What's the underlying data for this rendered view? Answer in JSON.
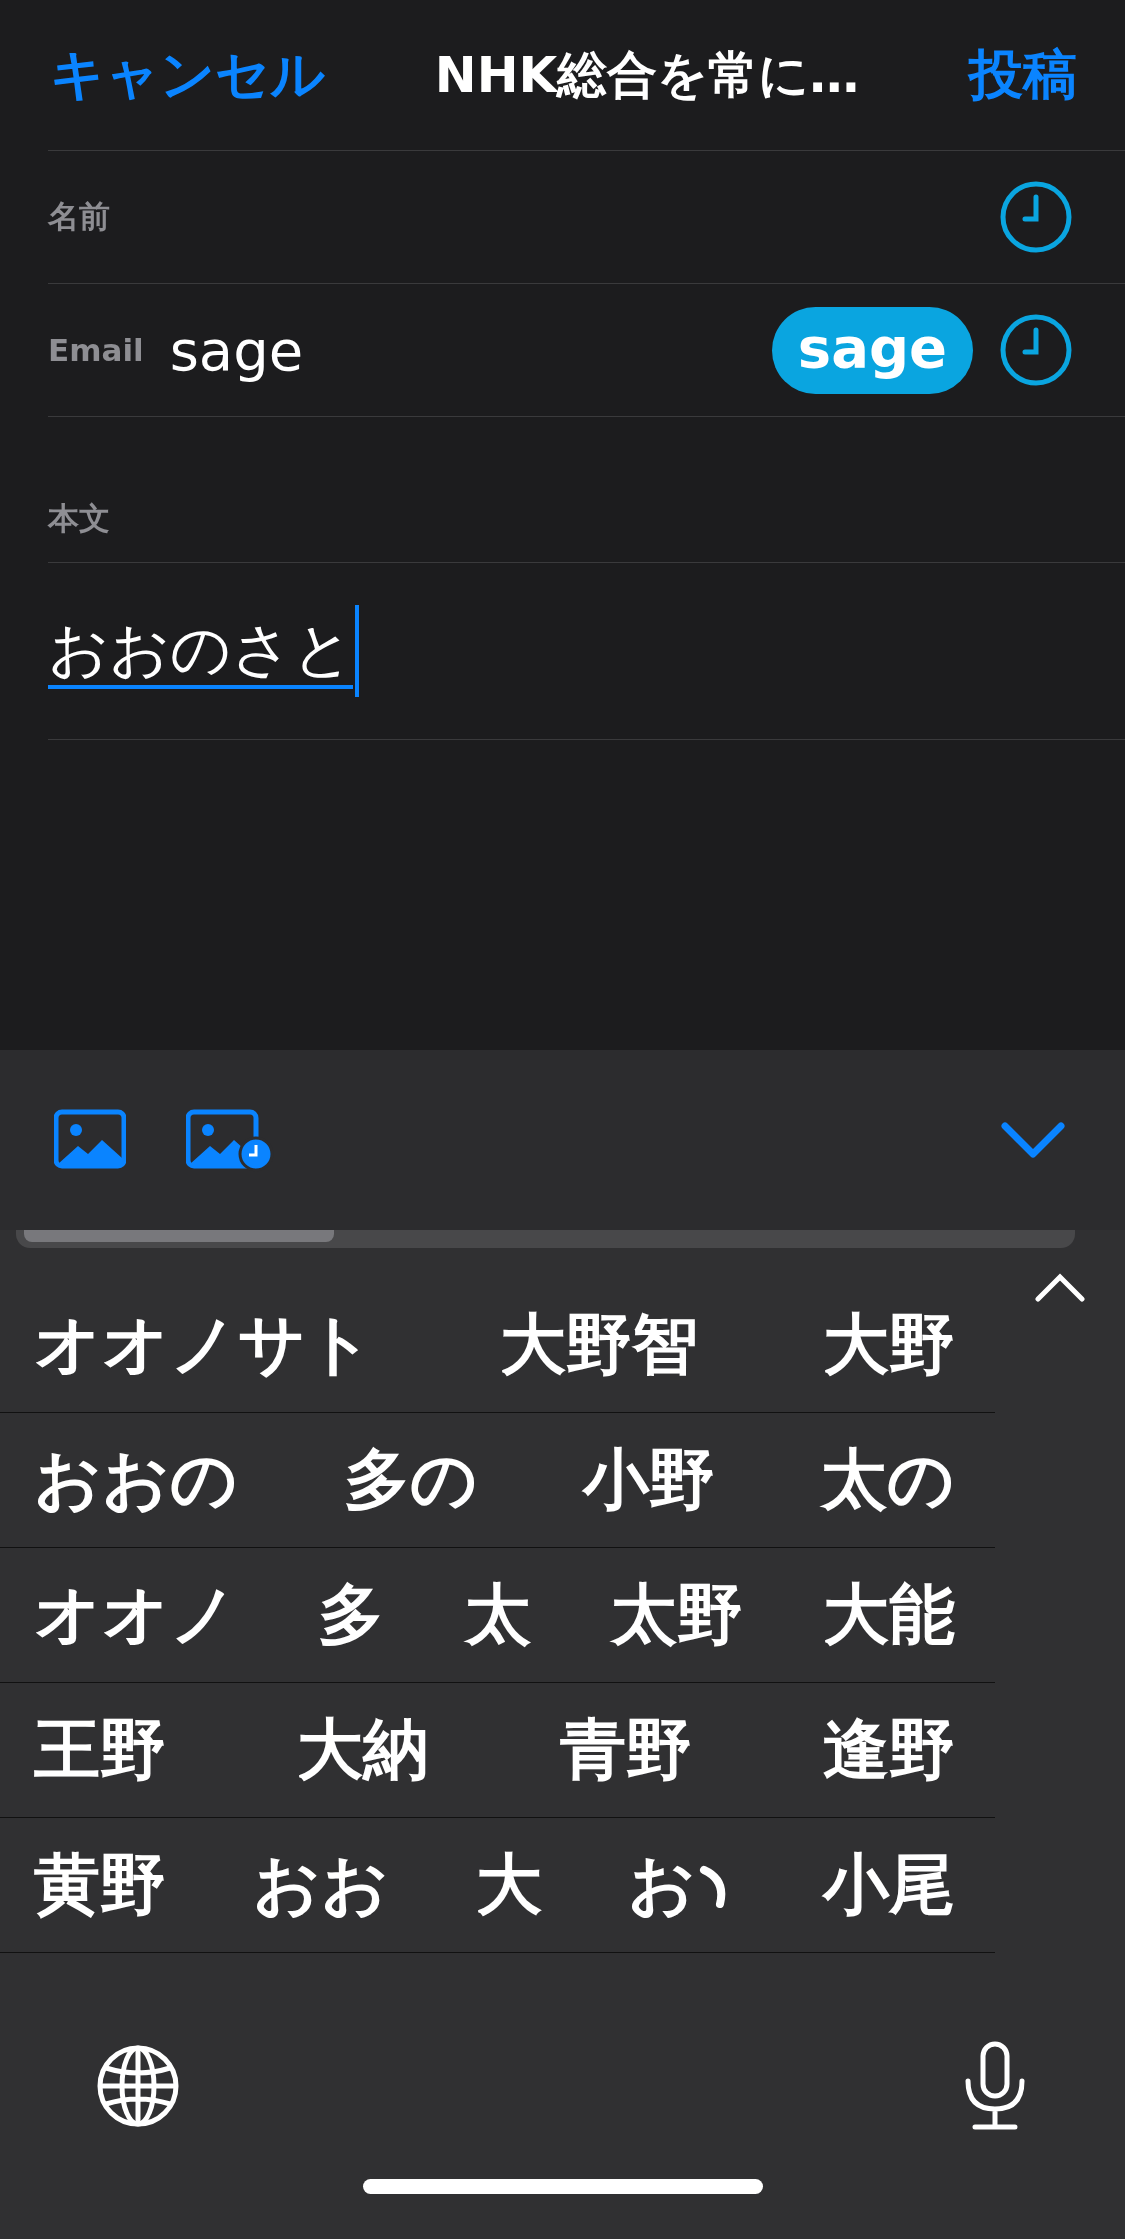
{
  "nav": {
    "cancel": "キャンセル",
    "title": "NHK総合を常に…",
    "post": "投稿"
  },
  "fields": [
    {
      "label": "名前"
    },
    {
      "label": "Email",
      "value": "sage",
      "suggestion": "sage"
    }
  ],
  "body": {
    "label": "本文",
    "value": "おおのさと"
  },
  "candidates": [
    [
      "オオノサト",
      "大野智",
      "大野"
    ],
    [
      "おおの",
      "多の",
      "小野",
      "太の"
    ],
    [
      "オオノ",
      "多",
      "太",
      "太野",
      "大能"
    ],
    [
      "王野",
      "大納",
      "青野",
      "逢野"
    ],
    [
      "黄野",
      "おお",
      "大",
      {
        "text": "お",
        "kind": "iteration-mark"
      },
      "小尾"
    ]
  ]
}
